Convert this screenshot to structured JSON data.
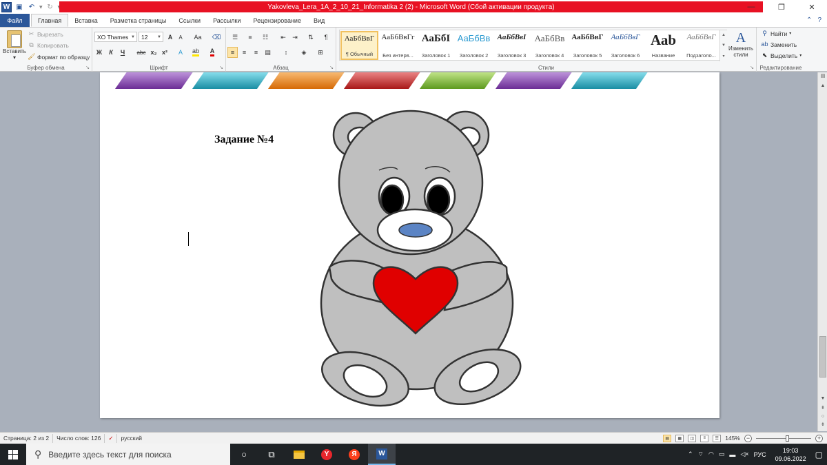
{
  "window": {
    "title": "Yakovleva_Lera_1A_2_10_21_Informatika 2 (2) - Microsoft Word (Сбой активации продукта)",
    "app_icon": "W",
    "controls": {
      "minimize": "—",
      "restore": "❐",
      "close": "✕"
    }
  },
  "tabs": [
    {
      "label": "Файл"
    },
    {
      "label": "Главная"
    },
    {
      "label": "Вставка"
    },
    {
      "label": "Разметка страницы"
    },
    {
      "label": "Ссылки"
    },
    {
      "label": "Рассылки"
    },
    {
      "label": "Рецензирование"
    },
    {
      "label": "Вид"
    }
  ],
  "ribbon": {
    "clipboard": {
      "paste": "Вставить",
      "cut": "Вырезать",
      "copy": "Копировать",
      "format_painter": "Формат по образцу",
      "group": "Буфер обмена"
    },
    "font": {
      "name": "XO Thames",
      "size": "12",
      "grow": "A",
      "shrink": "A",
      "case": "Aa",
      "bold": "Ж",
      "italic": "К",
      "underline": "Ч",
      "strike": "abc",
      "subscript": "x₂",
      "superscript": "x²",
      "group": "Шрифт"
    },
    "paragraph": {
      "group": "Абзац",
      "pilcrow": "¶"
    },
    "styles": {
      "group": "Стили",
      "items": [
        {
          "sample": "АаБбВвГ",
          "name": "¶ Обычный",
          "selected": true
        },
        {
          "sample": "АаБбВвГг",
          "name": "Без интерв..."
        },
        {
          "sample": "АаБбІ",
          "name": "Заголовок 1"
        },
        {
          "sample": "АаБбВв",
          "name": "Заголовок 2"
        },
        {
          "sample": "АаБбВвІ",
          "name": "Заголовок 3"
        },
        {
          "sample": "АаБбВв",
          "name": "Заголовок 4"
        },
        {
          "sample": "АаБбВвГ",
          "name": "Заголовок 5"
        },
        {
          "sample": "АаБбВвГ",
          "name": "Заголовок 6"
        },
        {
          "sample": "Ааb",
          "name": "Название"
        },
        {
          "sample": "АаБбВвГ",
          "name": "Подзаголо..."
        }
      ],
      "change_styles": "Изменить стили"
    },
    "editing": {
      "find": "Найти",
      "replace": "Заменить",
      "select": "Выделить",
      "group": "Редактирование"
    }
  },
  "document": {
    "heading": "Задание №4",
    "decor_colors": [
      "#8a4fb5",
      "#2bb3cc",
      "#f28a1e",
      "#d62f2f",
      "#8cc63e",
      "#8a4fb5",
      "#2bb3cc"
    ],
    "bear_colors": {
      "body": "#bfbfbf",
      "heart": "#e00000",
      "nose": "#5b84c4",
      "outline": "#333333"
    }
  },
  "statusbar": {
    "page": "Страница: 2 из 2",
    "words": "Число слов: 126",
    "language": "русский",
    "zoom": "145%",
    "zoom_fraction": 0.57
  },
  "taskbar": {
    "search_placeholder": "Введите здесь текст для поиска",
    "lang": "РУС",
    "time": "19:03",
    "date": "09.06.2022"
  }
}
